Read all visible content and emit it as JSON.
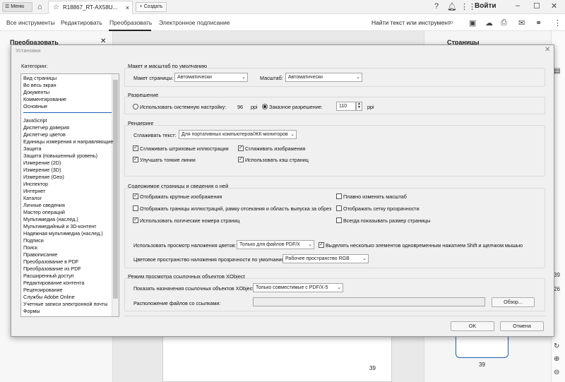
{
  "topbar": {
    "menu_label": "Меню",
    "doc_tab_title": "R18867_RT-AX58U...",
    "create_label": "+ Создать",
    "signin_label": "Войти"
  },
  "tools": {
    "tabs": [
      "Все инструменты",
      "Редактировать",
      "Преобразовать",
      "Электронное подписание"
    ],
    "active_tab": "Преобразовать",
    "find_label": "Найти текст или инструмент"
  },
  "left_panel": {
    "title": "Преобразовать"
  },
  "right_panel": {
    "title": "Страницы",
    "thumb_page": "39",
    "rail_number_a": "39",
    "rail_number_b": "26"
  },
  "document": {
    "page_number": "39"
  },
  "dialog": {
    "title": "Установки",
    "categories_label": "Категории:",
    "categories_top": [
      "Вид страницы",
      "Во весь экран",
      "Документы",
      "Комментирование",
      "Основные"
    ],
    "categories_rest": [
      "JavaScript",
      "Диспетчер доверия",
      "Диспетчер цветов",
      "Единицы измерения и направляющие",
      "Защита",
      "Защита (повышенный уровень)",
      "Измерение (2D)",
      "Измерение (3D)",
      "Измерение (Geo)",
      "Инспектор",
      "Интернет",
      "Каталог",
      "Личные сведения",
      "Мастер операций",
      "Мультимедиа (наслед.)",
      "Мультимедийный и 3D-контент",
      "Надежная мультимедиа (наслед.)",
      "Подписи",
      "Поиск",
      "Правописание",
      "Преобразование в PDF",
      "Преобразование из PDF",
      "Расширенный доступ",
      "Редактирование контента",
      "Рецензирование",
      "Службы Adobe Online",
      "Учетные записи электронной почты",
      "Формы"
    ],
    "selected_category": "Вид страницы",
    "layout": {
      "title": "Макет и масштаб по умолчанию",
      "page_layout_label": "Макет страницы:",
      "page_layout_value": "Автоматически",
      "zoom_label": "Масштаб:",
      "zoom_value": "Автоматически"
    },
    "resolution": {
      "title": "Разрешение",
      "system_label": "Использовать системную настройку:",
      "system_value": "96",
      "system_unit": "ppi",
      "custom_label": "Заказное разрешение:",
      "custom_value": "110",
      "custom_unit": "ppi"
    },
    "rendering": {
      "title": "Рендеринг",
      "smooth_text_label": "Сглаживать текст:",
      "smooth_text_value": "Для портативных компьютеров/ЖК-мониторов",
      "cb_line_art": "Сглаживать штриховые иллюстрации",
      "cb_images": "Сглаживать изображения",
      "cb_thin_lines": "Улучшать тонкие линии",
      "cb_page_cache": "Использовать кэш страниц"
    },
    "page_content": {
      "title": "Содержимое страницы и сведения о ней",
      "cb_large_images": "Отображать крупные изображения",
      "cb_smooth_zoom": "Плавно изменять масштаб",
      "cb_art_trim_bleed": "Отображать границы иллюстраций, рамку отсекания и область выпуска за обрез",
      "cb_transparency_grid": "Отображать сетку прозрачности",
      "cb_logical_page_numbers": "Использовать логические номера страниц",
      "cb_always_page_size": "Всегда показывать размер страницы",
      "overprint_label": "Использовать просмотр наложения цветов:",
      "overprint_value": "Только для файлов PDF/X",
      "cb_shift_select": "Выделять несколько элементов одновременным нажатием Shift и щелчком мышью",
      "blend_space_label": "Цветовое пространство наложения прозрачности по умолчанию:",
      "blend_space_value": "Рабочее пространство RGB"
    },
    "xobject": {
      "title": "Режим просмотра ссылочных объектов XObject",
      "show_targets_label": "Показать назначения ссылочных объектов XObject:",
      "show_targets_value": "Только совместимые с PDF/X-5",
      "location_label": "Расположение файлов со ссылками:",
      "location_value": "",
      "browse_label": "Обзор..."
    },
    "ok_label": "OK",
    "cancel_label": "Отмена"
  }
}
